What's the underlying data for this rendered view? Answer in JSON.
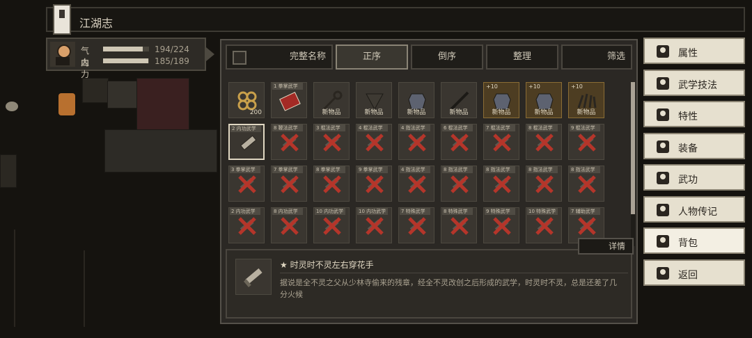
{
  "header": {
    "title": "江湖志"
  },
  "status": {
    "hp": {
      "label": "气血",
      "value": "194/224",
      "fraction": 0.866
    },
    "mp": {
      "label": "内力",
      "value": "185/189",
      "fraction": 0.979
    }
  },
  "toolbar": {
    "sort_name": "完整名称",
    "asc": "正序",
    "desc": "倒序",
    "organize": "整理",
    "filter": "筛选"
  },
  "items": [
    {
      "caption": "",
      "tag": "",
      "foot": "",
      "qty": "200",
      "kind": "coins",
      "gold": false
    },
    {
      "caption": "1 拳掌武学",
      "tag": "",
      "foot": "",
      "qty": "",
      "kind": "book",
      "gold": false
    },
    {
      "caption": "",
      "tag": "",
      "foot": "新物品",
      "qty": "",
      "kind": "key",
      "gold": false
    },
    {
      "caption": "",
      "tag": "",
      "foot": "新物品",
      "qty": "",
      "kind": "bag",
      "gold": false
    },
    {
      "caption": "",
      "tag": "",
      "foot": "新物品",
      "qty": "",
      "kind": "armor",
      "gold": false
    },
    {
      "caption": "",
      "tag": "",
      "foot": "新物品",
      "qty": "",
      "kind": "weapon",
      "gold": false
    },
    {
      "caption": "",
      "tag": "+10",
      "foot": "新物品",
      "qty": "",
      "kind": "armor",
      "gold": true
    },
    {
      "caption": "",
      "tag": "+10",
      "foot": "新物品",
      "qty": "",
      "kind": "armor",
      "gold": true
    },
    {
      "caption": "",
      "tag": "+10",
      "foot": "新物品",
      "qty": "",
      "kind": "claw",
      "gold": true
    },
    {
      "caption": "2 内功武学",
      "tag": "",
      "foot": "",
      "qty": "",
      "kind": "scroll",
      "gold": false,
      "selected": true
    },
    {
      "caption": "8 鞭法武学",
      "kind": "crossed"
    },
    {
      "caption": "3 棍法武学",
      "kind": "crossed"
    },
    {
      "caption": "4 棍法武学",
      "kind": "crossed"
    },
    {
      "caption": "4 指法武学",
      "kind": "crossed"
    },
    {
      "caption": "6 棍法武学",
      "kind": "crossed"
    },
    {
      "caption": "7 棍法武学",
      "kind": "crossed"
    },
    {
      "caption": "8 棍法武学",
      "kind": "crossed"
    },
    {
      "caption": "9 棍法武学",
      "kind": "crossed"
    },
    {
      "caption": "3 拳掌武学",
      "kind": "crossed"
    },
    {
      "caption": "7 拳掌武学",
      "kind": "crossed"
    },
    {
      "caption": "8 拳掌武学",
      "kind": "crossed"
    },
    {
      "caption": "9 拳掌武学",
      "kind": "crossed"
    },
    {
      "caption": "4 指法武学",
      "kind": "crossed"
    },
    {
      "caption": "8 指法武学",
      "kind": "crossed"
    },
    {
      "caption": "8 指法武学",
      "kind": "crossed"
    },
    {
      "caption": "8 指法武学",
      "kind": "crossed"
    },
    {
      "caption": "8 指法武学",
      "kind": "crossed"
    },
    {
      "caption": "2 内功武学",
      "kind": "crossed"
    },
    {
      "caption": "8 内功武学",
      "kind": "crossed"
    },
    {
      "caption": "10 内功武学",
      "kind": "crossed"
    },
    {
      "caption": "10 内功武学",
      "kind": "crossed"
    },
    {
      "caption": "7 特殊武学",
      "kind": "crossed"
    },
    {
      "caption": "8 特殊武学",
      "kind": "crossed"
    },
    {
      "caption": "9 特殊武学",
      "kind": "crossed"
    },
    {
      "caption": "10 特殊武学",
      "kind": "crossed"
    },
    {
      "caption": "7 辅助武学",
      "kind": "crossed"
    }
  ],
  "detail": {
    "title": "★ 时灵时不灵左右穿花手",
    "description": "据说是全不灵之父从少林寺偷来的残章，经全不灵改创之后形成的武学，时灵时不灵，总是还差了几分火候",
    "button": "详情"
  },
  "menu": [
    {
      "label": "属性",
      "icon": "person-icon"
    },
    {
      "label": "武学技法",
      "icon": "martial-icon"
    },
    {
      "label": "特性",
      "icon": "trait-icon"
    },
    {
      "label": "装备",
      "icon": "sword-icon"
    },
    {
      "label": "武功",
      "icon": "manual-icon"
    },
    {
      "label": "人物传记",
      "icon": "biography-icon"
    },
    {
      "label": "背包",
      "icon": "backpack-icon",
      "active": true
    },
    {
      "label": "返回",
      "icon": "return-icon"
    }
  ],
  "colors": {
    "accent": "#e6e0cf",
    "gold_slot": "#4d3d22",
    "cross": "#b5352a"
  }
}
